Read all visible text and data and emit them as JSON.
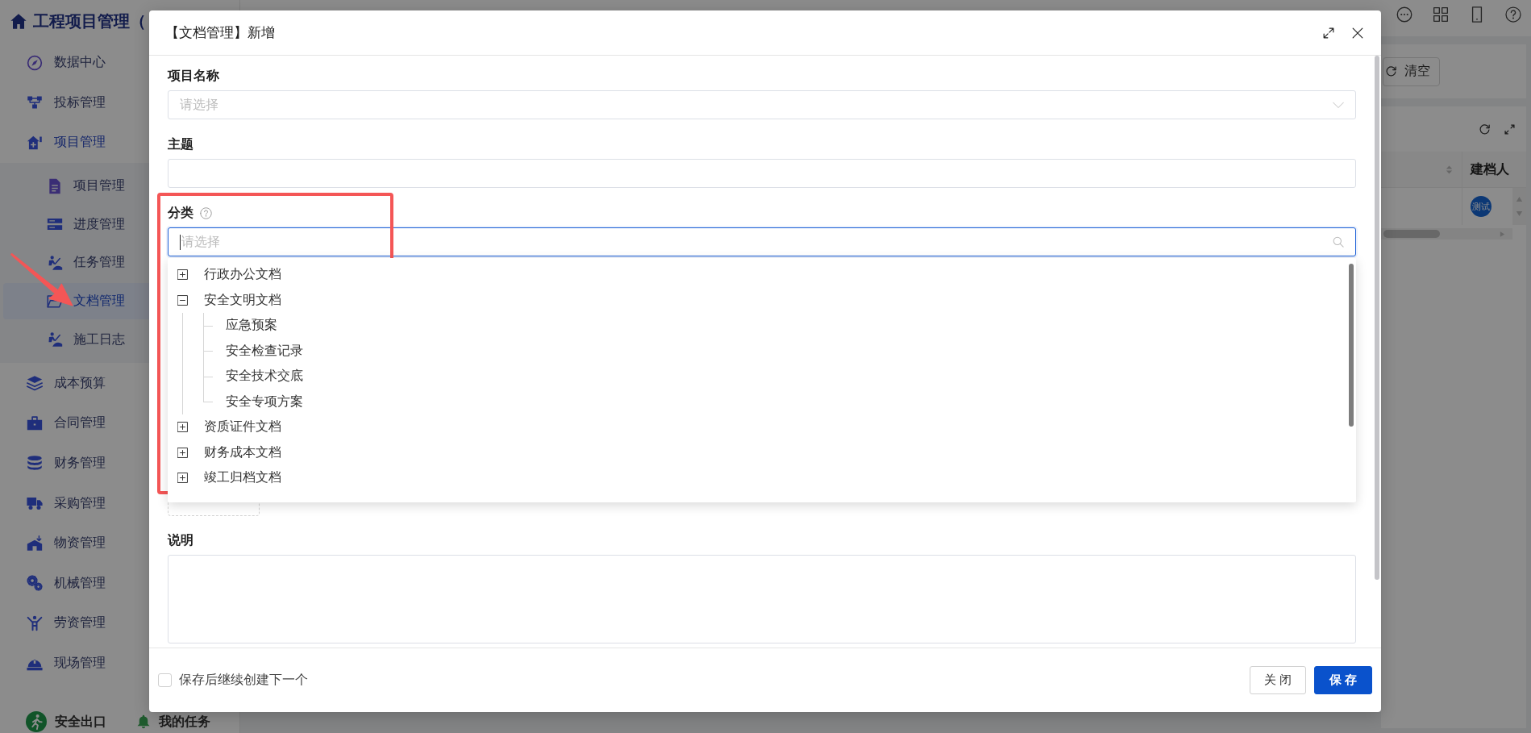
{
  "sidebar": {
    "title": "工程项目管理（",
    "items": [
      {
        "label": "数据中心",
        "selected": false
      },
      {
        "label": "投标管理",
        "selected": false
      },
      {
        "label": "项目管理",
        "selected": false,
        "children": [
          {
            "label": "项目管理",
            "selected": false
          },
          {
            "label": "进度管理",
            "selected": false
          },
          {
            "label": "任务管理",
            "selected": false
          },
          {
            "label": "文档管理",
            "selected": true
          },
          {
            "label": "施工日志",
            "selected": false
          }
        ]
      },
      {
        "label": "成本预算",
        "selected": false
      },
      {
        "label": "合同管理",
        "selected": false
      },
      {
        "label": "财务管理",
        "selected": false
      },
      {
        "label": "采购管理",
        "selected": false
      },
      {
        "label": "物资管理",
        "selected": false
      },
      {
        "label": "机械管理",
        "selected": false
      },
      {
        "label": "劳资管理",
        "selected": false
      },
      {
        "label": "现场管理",
        "selected": false
      }
    ],
    "footer_links": [
      {
        "label": "安全出口"
      },
      {
        "label": "我的任务"
      }
    ]
  },
  "search_panel": {
    "clear_button": "清空"
  },
  "table": {
    "columns": [
      {
        "label": "建档人",
        "kind": "avatar"
      }
    ],
    "rows": [
      {
        "cells": [
          "测试"
        ]
      }
    ]
  },
  "dialog": {
    "title": "【文档管理】新增",
    "fields": [
      {
        "kind": "select",
        "label": "项目名称",
        "placeholder": "请选择",
        "help_icon": false,
        "focused": false
      },
      {
        "kind": "input",
        "label": "主题",
        "help_icon": false,
        "focused": false
      },
      {
        "kind": "tree_select",
        "label": "分类",
        "placeholder": "请选择",
        "help_icon": true,
        "focused": true,
        "dropdown": {
          "nodes": [
            {
              "label": "行政办公文档",
              "expanded": false,
              "selected": false
            },
            {
              "label": "安全文明文档",
              "expanded": true,
              "selected": false,
              "children": [
                {
                  "label": "应急预案",
                  "selected": false
                },
                {
                  "label": "安全检查记录",
                  "selected": false
                },
                {
                  "label": "安全技术交底",
                  "selected": false
                },
                {
                  "label": "安全专项方案",
                  "selected": false
                }
              ]
            },
            {
              "label": "资质证件文档",
              "expanded": false,
              "selected": false
            },
            {
              "label": "财务成本文档",
              "expanded": false,
              "selected": false
            },
            {
              "label": "竣工归档文档",
              "expanded": false,
              "selected": false
            }
          ]
        }
      },
      {
        "kind": "upload",
        "focused": false
      },
      {
        "kind": "textarea",
        "label": "说明",
        "help_icon": false,
        "focused": false
      }
    ],
    "footer": {
      "checkbox": {
        "label": "保存后继续创建下一个",
        "checked": false
      },
      "buttons": [
        {
          "label": "关 闭",
          "kind": "default"
        },
        {
          "label": "保 存",
          "kind": "primary"
        }
      ]
    }
  }
}
